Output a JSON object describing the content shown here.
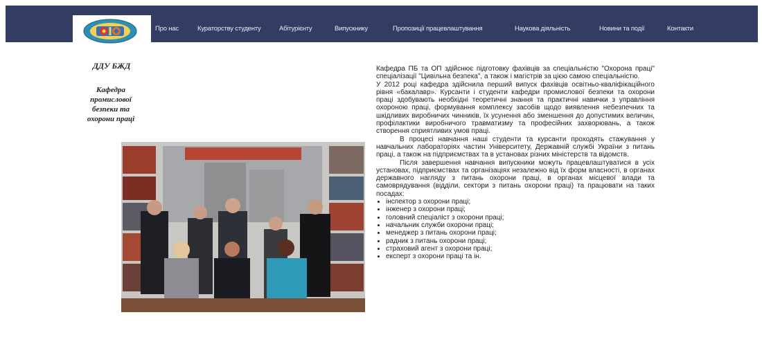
{
  "nav": {
    "items": [
      "Про нас",
      "Кураторству студенту",
      "Абітурієнту",
      "Випускнику",
      "Пропозиції працевлаштування",
      "Наукова діяльність",
      "Новини та події",
      "Контакти"
    ]
  },
  "sidebar": {
    "org_short": "ДДУ БЖД",
    "dept_name": [
      "Кафедра",
      "промислової",
      "безпеки та",
      "охорони праці"
    ]
  },
  "article": {
    "paragraphs": [
      "Кафедра ПБ та ОП здійснює підготовку фахівців за спеціальністю \"Охорона праці\" спеціалізації \"Цивільна безпека\", а також і магістрів за цією самою спеціальністю.",
      "У 2012 році кафедра здійснила перший випуск фахівців освітньо-кваліфікаційного рівня «бакалавр». Курсанти і студенти кафедри промислової безпеки та охорони праці здобувають необхідні теоретичні знання та практичні навички з управління охороною праці, формування комплексу засобів щодо виявлення небезпечних та шкідливих виробничих чинників, їх усунення або зменшення до допустимих величин, профілактики виробничого травматизму та професійних захворювань, а також створення сприятливих умов праці.",
      "В процесі навчання наші студенти та курсанти проходять стажування у навчальних лабораторіях частин Університету, Державній службі України з питань праці, а також на підприємствах та в установах різних міністерств та відомств.",
      "Після завершення навчання випускники можуть працевлаштуватися в усіх установах, підприємствах та організаціях незалежно від їх форм власності, в органах державного нагляду з питань охорони праці, в органах місцевої влади та самоврядування (відділи, сектори з питань охорони праці) та працювати на таких посадах:"
    ],
    "list": [
      "інспектор з охорони праці;",
      "інженер з охорони праці;",
      "головний спеціаліст з охорони праці;",
      "начальник служби охорони праці;",
      "менеджер з питань охорони праці;",
      "радник з питань охорони праці;",
      "страховий агент з охорони праці;",
      "експерт з охорони праці та ін."
    ]
  },
  "colors": {
    "navbar_bg": "#333d63",
    "nav_text": "#e9ecf6",
    "page_bg": "#ffffff"
  }
}
